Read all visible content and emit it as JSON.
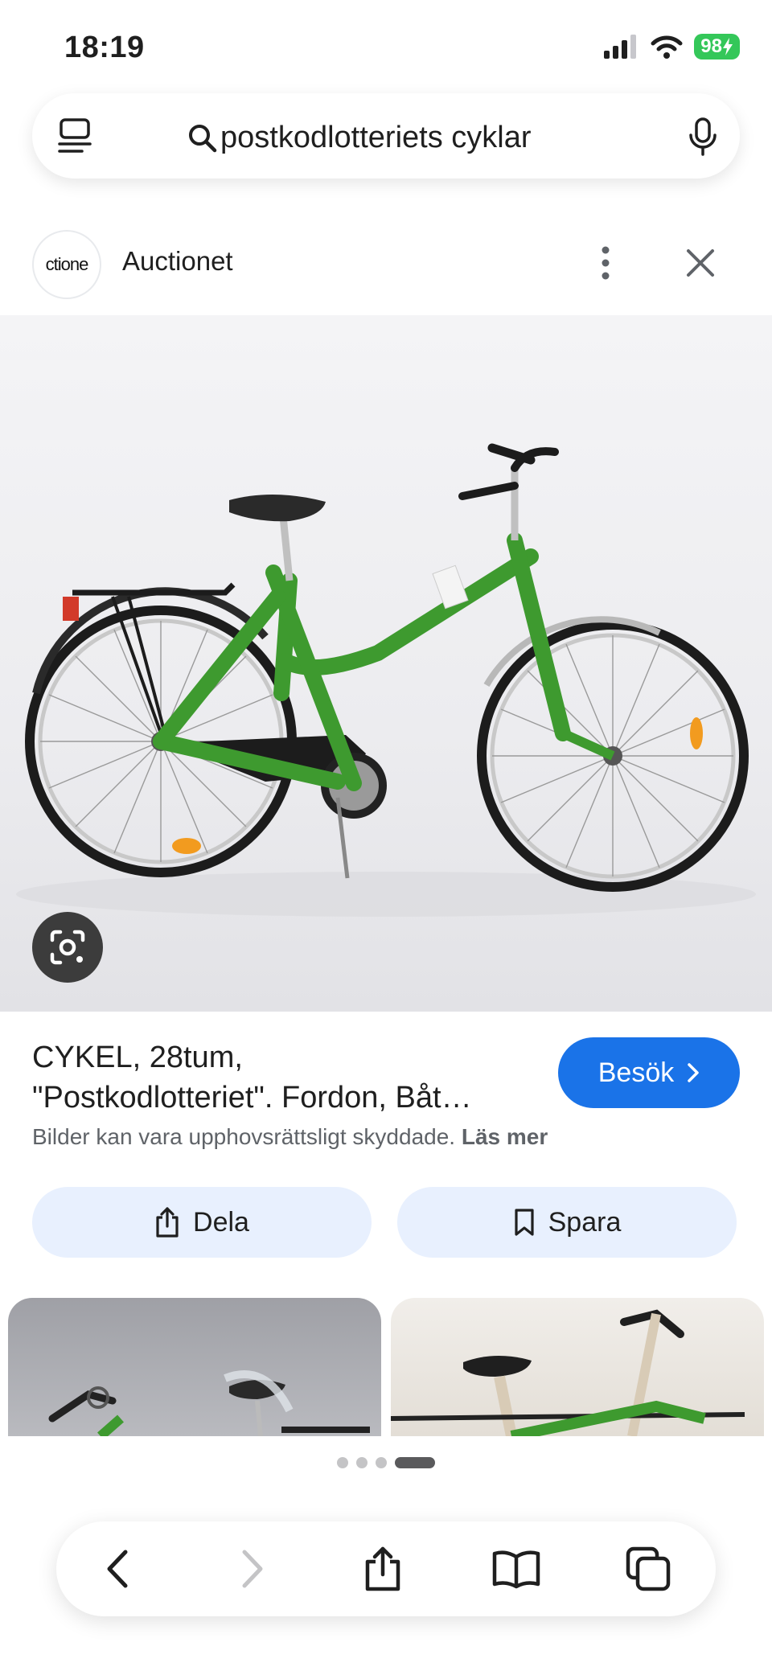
{
  "status_bar": {
    "time": "18:19",
    "battery": "98"
  },
  "search": {
    "query": "postkodlotteriets cyklar"
  },
  "source": {
    "avatar_text": "ctione",
    "name": "Auctionet"
  },
  "result": {
    "title_line1": "CYKEL, 28tum,",
    "title_line2": "\"Postkodlotteriet\". Fordon, Båt…",
    "visit_label": "Besök",
    "copyright_text": "Bilder kan vara upphovsrättsligt skyddade.",
    "read_more": "Läs mer"
  },
  "actions": {
    "share_label": "Dela",
    "save_label": "Spara"
  },
  "pagination": {
    "total": 4,
    "active_index": 3
  },
  "colors": {
    "accent": "#1a73e8",
    "pill_bg": "#e8f0fe",
    "bike_green": "#3e9a2f",
    "battery": "#34c759"
  }
}
